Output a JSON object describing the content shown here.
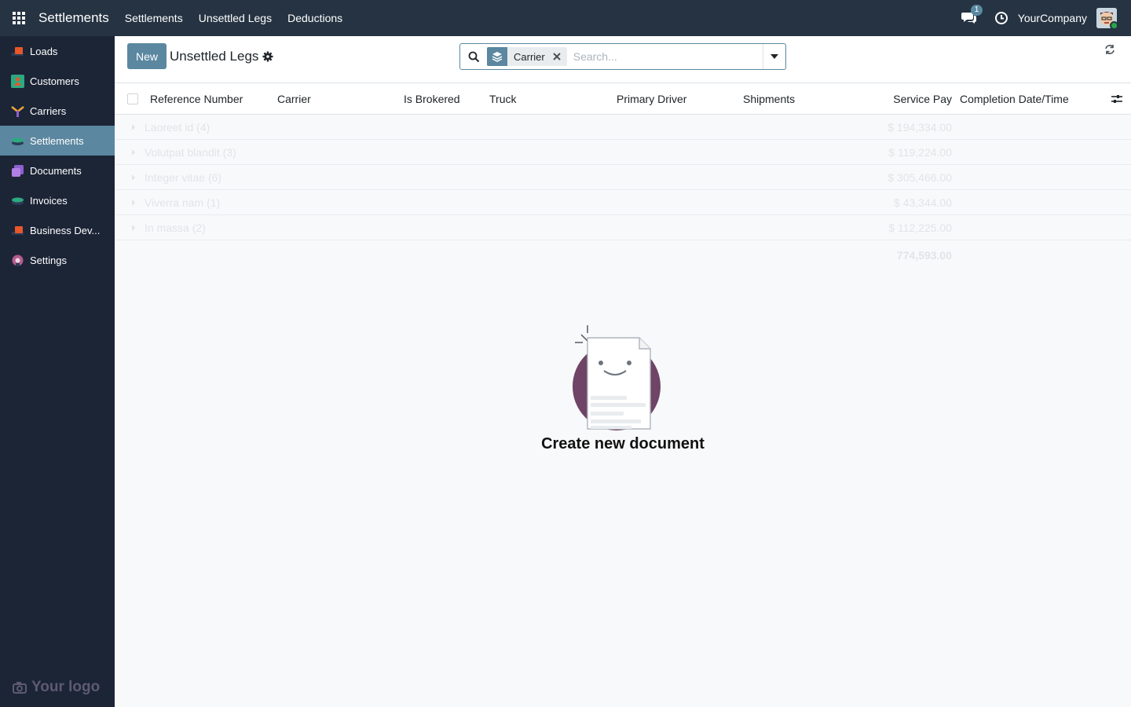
{
  "app": {
    "title": "Settlements"
  },
  "topnav": {
    "items": [
      "Settlements",
      "Unsettled Legs",
      "Deductions"
    ]
  },
  "systray": {
    "chat_count": "1",
    "company": "YourCompany"
  },
  "sidebar": {
    "items": [
      {
        "label": "Loads",
        "icon": "truck-icon",
        "color": "#e8562a"
      },
      {
        "label": "Customers",
        "icon": "customers-icon",
        "color": "#2ea881"
      },
      {
        "label": "Carriers",
        "icon": "carriers-icon",
        "color": "#f0a53a"
      },
      {
        "label": "Settlements",
        "icon": "settlements-icon",
        "color": "#2ea881",
        "active": true
      },
      {
        "label": "Documents",
        "icon": "documents-icon",
        "color": "#8e5fcf"
      },
      {
        "label": "Invoices",
        "icon": "invoices-icon",
        "color": "#2ea881"
      },
      {
        "label": "Business Dev...",
        "icon": "business-dev-icon",
        "color": "#e8562a"
      },
      {
        "label": "Settings",
        "icon": "settings-icon",
        "color": "#b55b8c"
      }
    ],
    "logo_text": "Your logo"
  },
  "control_panel": {
    "new_label": "New",
    "title": "Unsettled Legs",
    "search": {
      "facet_label": "Carrier",
      "placeholder": "Search..."
    }
  },
  "list": {
    "columns": [
      "Reference Number",
      "Carrier",
      "Is Brokered",
      "Truck",
      "Primary Driver",
      "Shipments",
      "Service Pay",
      "Completion Date/Time"
    ],
    "groups": [
      {
        "name": "Laoreet id (4)",
        "value": "$ 194,334.00"
      },
      {
        "name": "Volutpat blandit (3)",
        "value": "$ 119,224.00"
      },
      {
        "name": "Integer vitae (6)",
        "value": "$ 305,466.00"
      },
      {
        "name": "Viverra nam (1)",
        "value": "$ 43,344.00"
      },
      {
        "name": "In massa (2)",
        "value": "$ 112,225.00"
      }
    ],
    "total": "774,593.00"
  },
  "empty_state": {
    "title": "Create new document"
  },
  "colors": {
    "navbar": "#253342",
    "sidebar": "#1c2536",
    "primary": "#5b87a0",
    "illustration_circle": "#6f4466"
  }
}
